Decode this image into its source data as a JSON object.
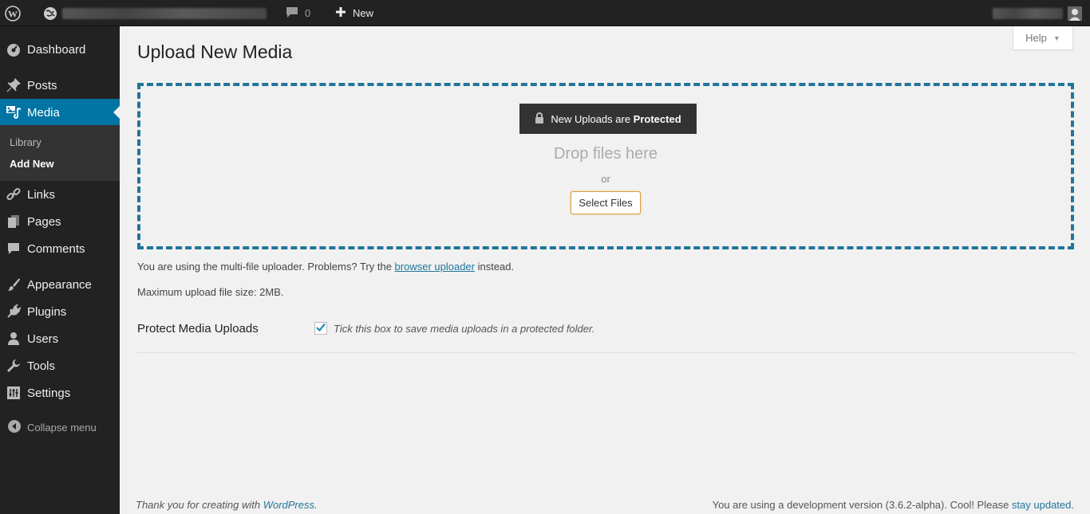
{
  "admin_bar": {
    "comments_count": "0",
    "new_label": "New"
  },
  "sidebar": {
    "items": [
      {
        "label": "Dashboard",
        "icon": "dashboard-icon"
      },
      {
        "label": "Posts",
        "icon": "pin-icon"
      },
      {
        "label": "Media",
        "icon": "media-icon",
        "current": true
      },
      {
        "label": "Links",
        "icon": "link-icon"
      },
      {
        "label": "Pages",
        "icon": "pages-icon"
      },
      {
        "label": "Comments",
        "icon": "comment-bubble-icon"
      },
      {
        "label": "Appearance",
        "icon": "paintbrush-icon"
      },
      {
        "label": "Plugins",
        "icon": "plug-icon"
      },
      {
        "label": "Users",
        "icon": "user-icon"
      },
      {
        "label": "Tools",
        "icon": "wrench-icon"
      },
      {
        "label": "Settings",
        "icon": "settings-icon"
      }
    ],
    "submenu": [
      "Library",
      "Add New"
    ],
    "collapse_label": "Collapse menu"
  },
  "help": {
    "label": "Help"
  },
  "page": {
    "title": "Upload New Media",
    "protect_button": {
      "prefix": "New Uploads are ",
      "bold": "Protected"
    },
    "drop_text": "Drop files here",
    "or_text": "or",
    "select_files": "Select Files",
    "uploader_info": {
      "before": "You are using the multi-file uploader. Problems? Try the ",
      "link": "browser uploader",
      "after": " instead."
    },
    "max_size": "Maximum upload file size: 2MB.",
    "protect_label": "Protect Media Uploads",
    "protect_checked": true,
    "protect_desc": "Tick this box to save media uploads in a protected folder."
  },
  "footer": {
    "left_text": "Thank you for creating with ",
    "left_link": "WordPress",
    "left_end": ".",
    "right_text": "You are using a development version (3.6.2-alpha). Cool! Please ",
    "right_link": "stay updated",
    "right_end": "."
  },
  "colors": {
    "admin_bar": "#222222",
    "sidebar": "#222222",
    "current_menu": "#0074a2",
    "dropzone_border": "#21759b",
    "link": "#21759b"
  }
}
